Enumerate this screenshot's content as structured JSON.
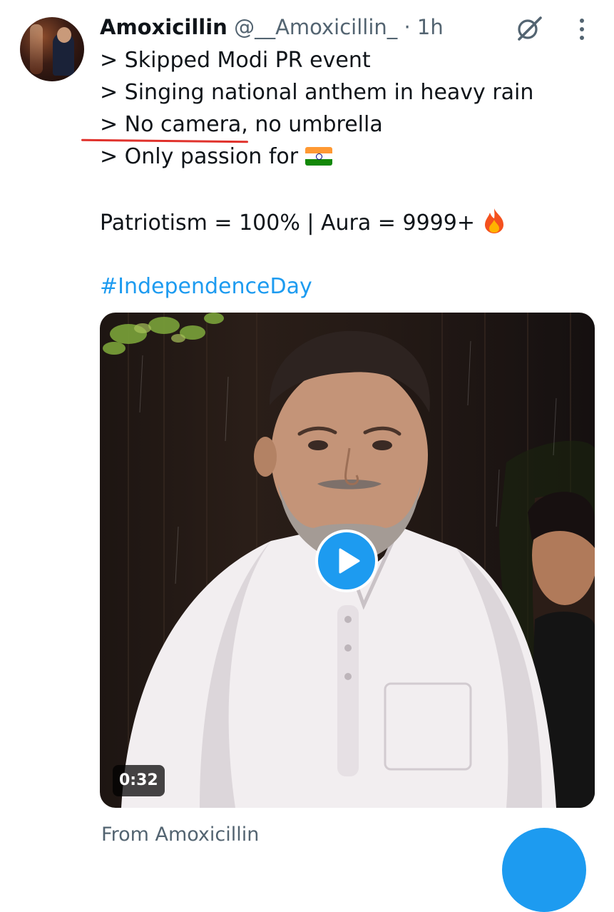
{
  "tweet": {
    "author_name": "Amoxicillin",
    "author_handle": "@__Amoxicillin_",
    "time": "· 1h",
    "lines": [
      "> Skipped Modi PR event",
      "> Singing national anthem in heavy rain",
      "> No camera, no umbrella",
      "> Only passion for "
    ],
    "stats_line": "Patriotism = 100% | Aura = 9999+ ",
    "hashtag": "#IndependenceDay"
  },
  "video": {
    "duration": "0:32"
  },
  "footer": {
    "from_text": "From Amoxicillin"
  },
  "icons": {
    "flag": "india-flag-emoji",
    "fire": "fire-emoji",
    "grok": "grok-icon",
    "more": "more-vertical-icon",
    "play": "play-icon"
  },
  "colors": {
    "link": "#1d9bf0",
    "secondary_text": "#536471",
    "annotation": "#e0322c"
  }
}
